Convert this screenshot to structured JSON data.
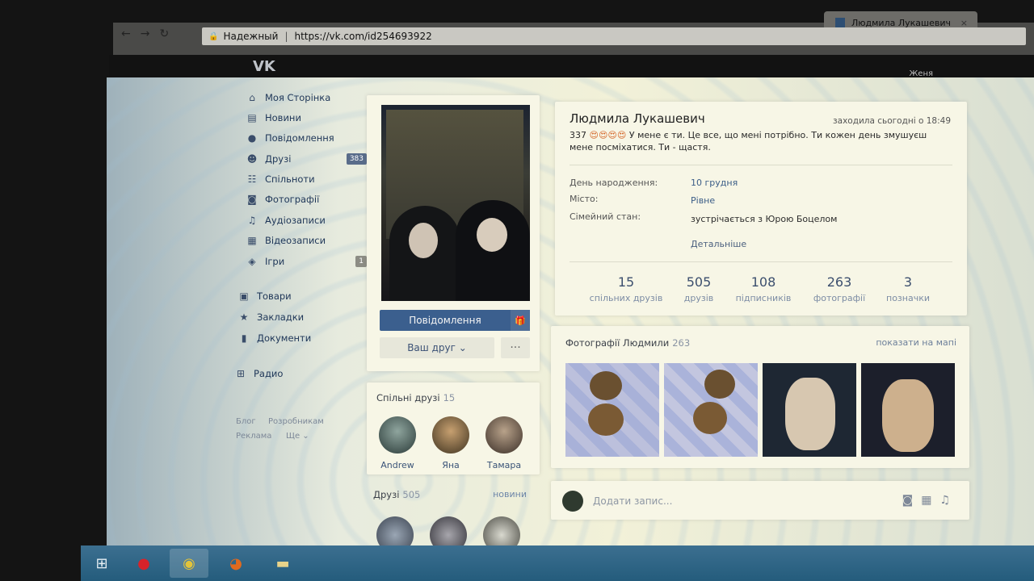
{
  "browser": {
    "tab_title": "Людмила Лукашевич",
    "secure_label": "Надежный",
    "url": "https://vk.com/id254693922"
  },
  "vk": {
    "logo": "VK",
    "user_name": "Женя"
  },
  "sidebar": {
    "items": [
      {
        "label": "Моя Сторінка",
        "icon": "home-icon"
      },
      {
        "label": "Новини",
        "icon": "news-icon"
      },
      {
        "label": "Повідомлення",
        "icon": "chat-icon"
      },
      {
        "label": "Друзі",
        "icon": "user-icon",
        "badge": "383"
      },
      {
        "label": "Спільноти",
        "icon": "group-icon"
      },
      {
        "label": "Фотографії",
        "icon": "camera-icon"
      },
      {
        "label": "Аудіозаписи",
        "icon": "music-icon"
      },
      {
        "label": "Відеозаписи",
        "icon": "film-icon"
      },
      {
        "label": "Ігри",
        "icon": "gamepad-icon",
        "badge": "1"
      },
      {
        "label": "Товари",
        "icon": "bag-icon"
      },
      {
        "label": "Закладки",
        "icon": "star-icon"
      },
      {
        "label": "Документи",
        "icon": "document-icon"
      },
      {
        "label": "Радио",
        "icon": "grid-icon"
      }
    ],
    "footer": {
      "blog": "Блог",
      "developers": "Розробникам",
      "ads": "Реклама",
      "more": "Ще ⌄"
    }
  },
  "profile": {
    "message_button": "Повідомлення",
    "friend_button": "Ваш друг ⌄",
    "more_button": "···",
    "name": "Людмила Лукашевич",
    "online": "заходила сьогодні о 18:49",
    "status_prefix": "337",
    "status_emoji": "😍😍😍😍",
    "status_text": "У мене є ти. Це все, що мені потрібно. Ти кожен день змушуєш мене посміхатися. Ти - щастя.",
    "details": [
      {
        "label": "День народження:",
        "value": "10 грудня"
      },
      {
        "label": "Місто:",
        "value": "Рівне"
      },
      {
        "label": "Сімейний стан:",
        "value": "зустрічається з Юрою Боцелом"
      }
    ],
    "more_info": "Детальніше",
    "stats": [
      {
        "count": "15",
        "label": "спільних друзів"
      },
      {
        "count": "505",
        "label": "друзів"
      },
      {
        "count": "108",
        "label": "підписників"
      },
      {
        "count": "263",
        "label": "фотографії"
      },
      {
        "count": "3",
        "label": "позначки"
      }
    ]
  },
  "common_friends": {
    "title": "Спільні друзі",
    "count": "15",
    "friends": [
      {
        "name": "Andrew"
      },
      {
        "name": "Яна"
      },
      {
        "name": "Тамара"
      }
    ]
  },
  "friends": {
    "title": "Друзі",
    "count": "505",
    "news_link": "новини"
  },
  "photos": {
    "title": "Фотографії Людмили",
    "count": "263",
    "map_link": "показати на мапі"
  },
  "post": {
    "placeholder": "Додати запис..."
  },
  "colors": {
    "vk_blue": "#3b5f8e",
    "link": "#3b5d87"
  }
}
